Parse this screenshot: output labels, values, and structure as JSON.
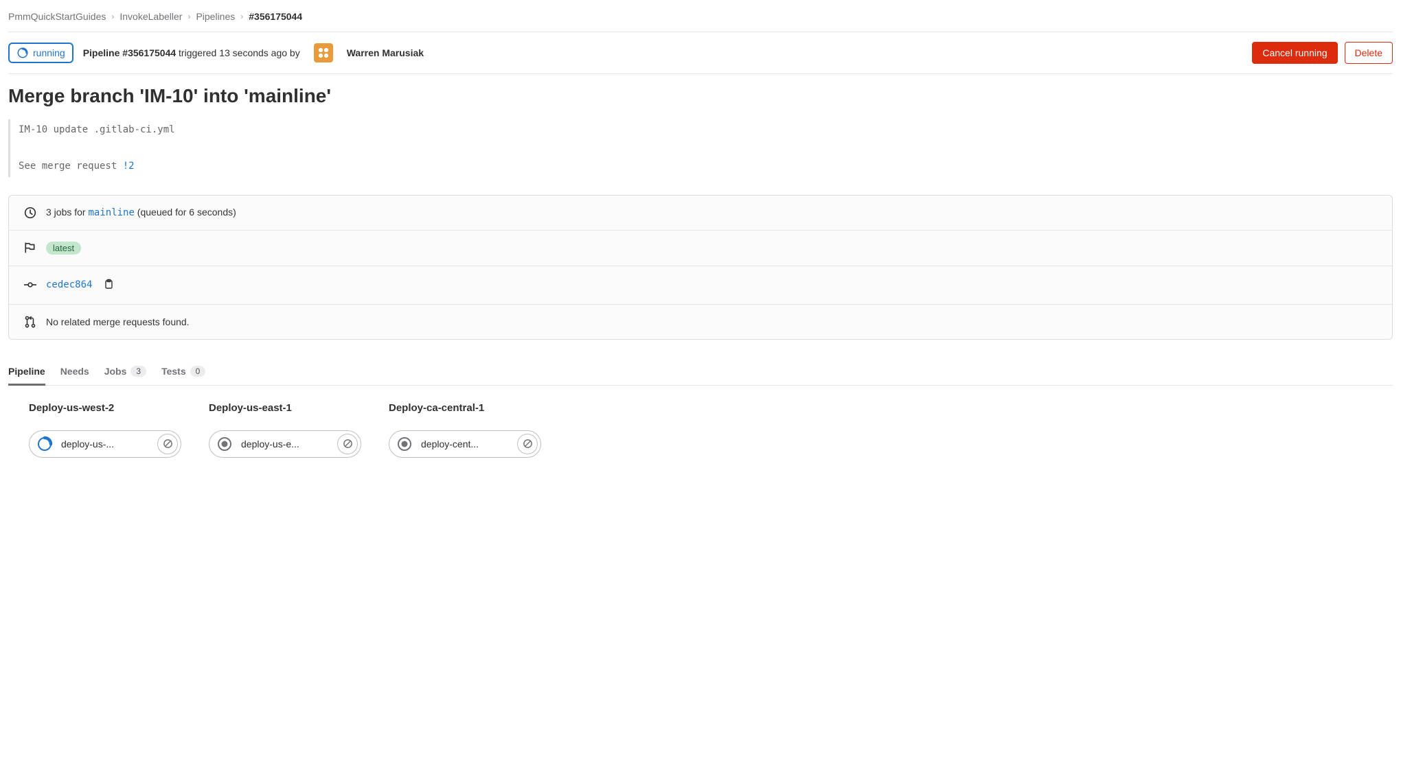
{
  "breadcrumb": {
    "items": [
      "PmmQuickStartGuides",
      "InvokeLabeller",
      "Pipelines"
    ],
    "current": "#356175044"
  },
  "header": {
    "status_label": "running",
    "pipeline_prefix": "Pipeline ",
    "pipeline_id": "#356175044",
    "triggered_text": " triggered 13 seconds ago by",
    "author": "Warren Marusiak",
    "actions": {
      "cancel": "Cancel running",
      "delete": "Delete"
    }
  },
  "title": "Merge branch 'IM-10' into 'mainline'",
  "commit_desc": {
    "line1": "IM-10 update .gitlab-ci.yml",
    "line2_prefix": "See merge request ",
    "mr_ref": "!2"
  },
  "info": {
    "jobs_prefix": "3 jobs for ",
    "branch": "mainline",
    "jobs_suffix": " (queued for 6 seconds)",
    "tag_latest": "latest",
    "commit_sha": "cedec864",
    "merge_requests": "No related merge requests found."
  },
  "tabs": [
    {
      "label": "Pipeline",
      "count": null,
      "active": true
    },
    {
      "label": "Needs",
      "count": null,
      "active": false
    },
    {
      "label": "Jobs",
      "count": "3",
      "active": false
    },
    {
      "label": "Tests",
      "count": "0",
      "active": false
    }
  ],
  "stages": [
    {
      "name": "Deploy-us-west-2",
      "job_label": "deploy-us-...",
      "status": "running"
    },
    {
      "name": "Deploy-us-east-1",
      "job_label": "deploy-us-e...",
      "status": "pending"
    },
    {
      "name": "Deploy-ca-central-1",
      "job_label": "deploy-cent...",
      "status": "pending"
    }
  ]
}
